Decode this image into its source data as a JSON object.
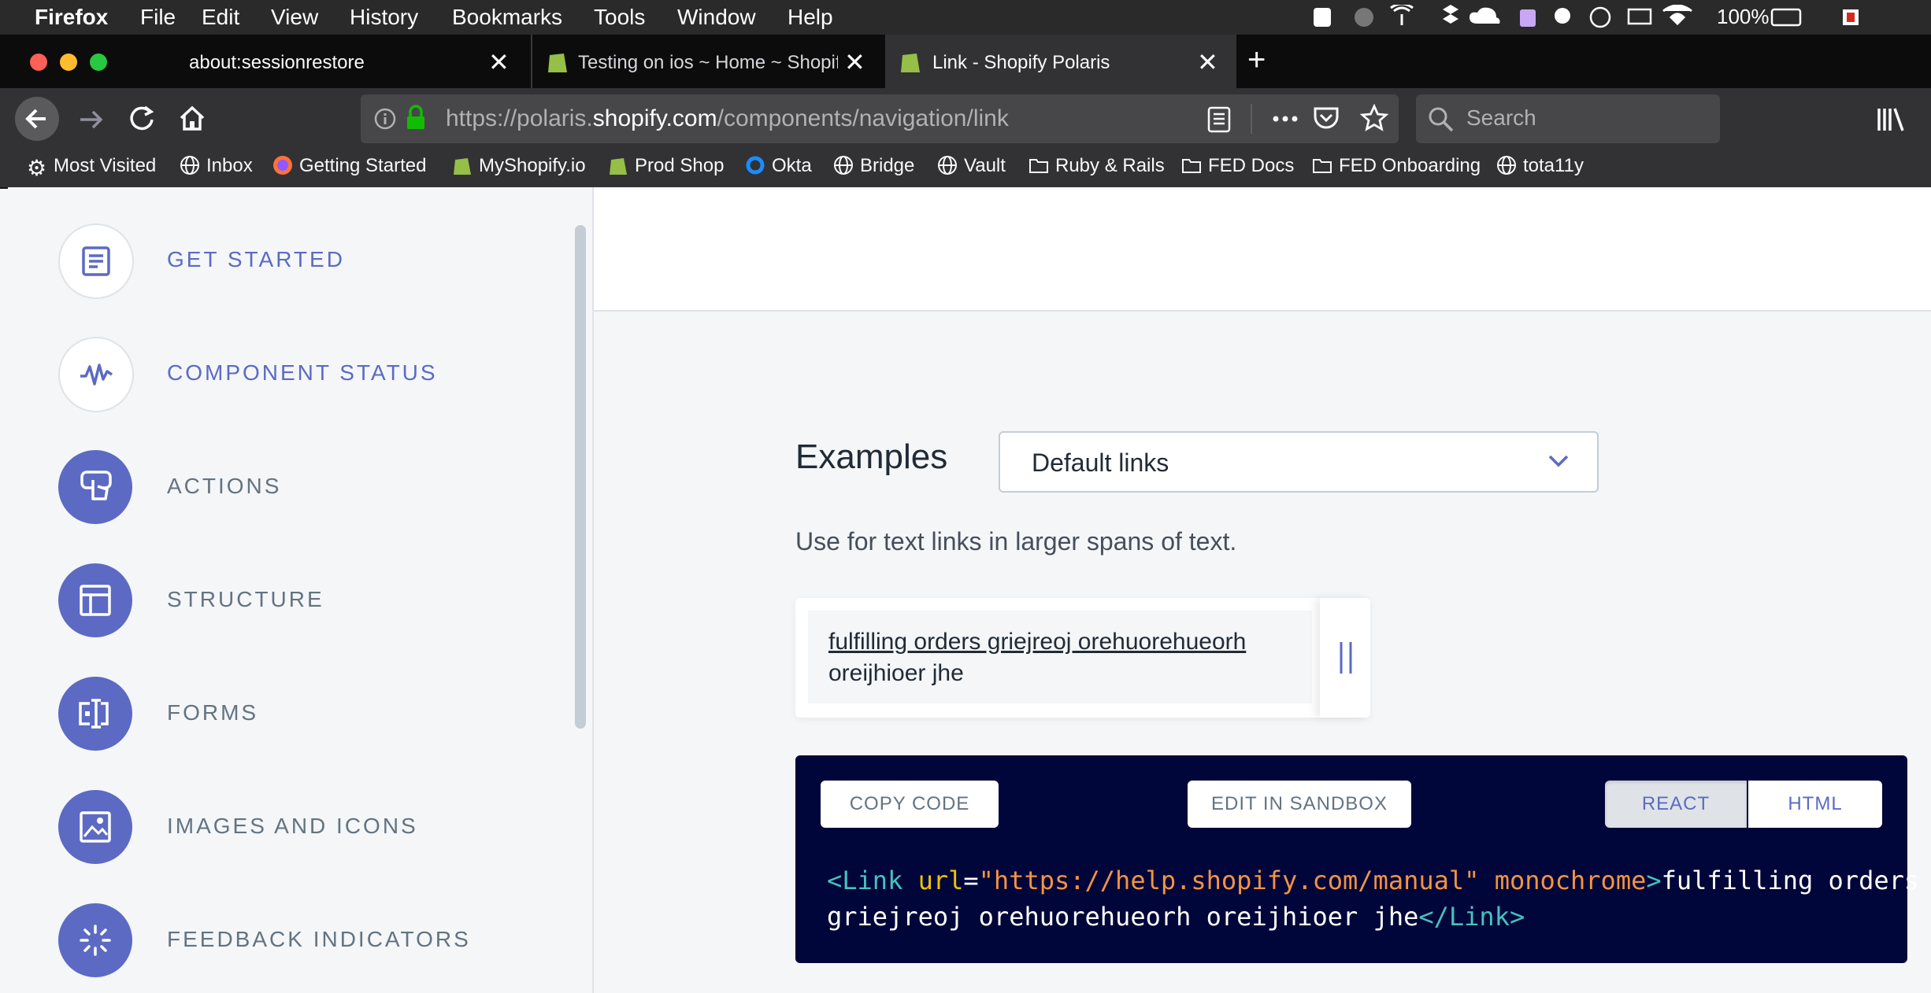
{
  "menubar": {
    "app": "Firefox",
    "items": [
      "File",
      "Edit",
      "View",
      "History",
      "Bookmarks",
      "Tools",
      "Window",
      "Help"
    ],
    "battery": "100%"
  },
  "tabs": [
    {
      "title": "about:sessionrestore"
    },
    {
      "title": "Testing on ios ~ Home ~ Shopif"
    },
    {
      "title": "Link - Shopify Polaris"
    }
  ],
  "urlbar": {
    "prefix": "https://polaris.",
    "domain": "shopify.com",
    "path": "/components/navigation/link"
  },
  "searchbar": {
    "placeholder": "Search"
  },
  "bookmarks": [
    "Most Visited",
    "Inbox",
    "Getting Started",
    "MyShopify.io",
    "Prod Shop",
    "Okta",
    "Bridge",
    "Vault",
    "Ruby & Rails",
    "FED Docs",
    "FED Onboarding",
    "tota11y"
  ],
  "sidebar": {
    "items": [
      {
        "label": "GET STARTED"
      },
      {
        "label": "COMPONENT STATUS"
      },
      {
        "label": "ACTIONS"
      },
      {
        "label": "STRUCTURE"
      },
      {
        "label": "FORMS"
      },
      {
        "label": "IMAGES AND ICONS"
      },
      {
        "label": "FEEDBACK INDICATORS"
      }
    ]
  },
  "examples": {
    "heading": "Examples",
    "selected": "Default links",
    "description": "Use for text links in larger spans of text.",
    "preview_link": "fulfilling orders griejreoj orehuorehueorh",
    "preview_rest": "oreijhioer jhe"
  },
  "code": {
    "copy": "COPY CODE",
    "sandbox": "EDIT IN SANDBOX",
    "react": "REACT",
    "html": "HTML",
    "tag_open": "<Link",
    "attr_url": "url",
    "eq": "=",
    "url_value": "\"https://help.shopify.com/manual\"",
    "attr_mono": "monochrome",
    "close_bracket": ">",
    "text1": "fulfilling orders",
    "text2": "griejreoj orehuorehueorh oreijhioer jhe",
    "tag_close": "</Link>"
  },
  "colors": {
    "accent": "#5c6ac4",
    "code_bg": "#000639"
  }
}
